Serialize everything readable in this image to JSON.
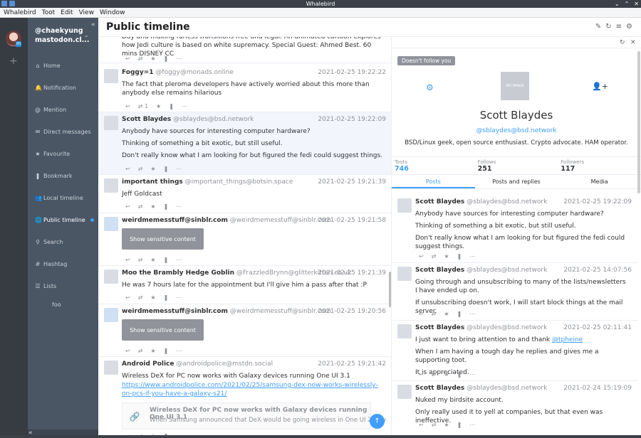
{
  "window": {
    "title": "Whalebird"
  },
  "menu": [
    "Whalebird",
    "Toot",
    "Edit",
    "View",
    "Window"
  ],
  "account": {
    "name": "@chaekyung",
    "server": "mastodon.cl..."
  },
  "nav": [
    {
      "icon": "⌂",
      "label": "Home"
    },
    {
      "icon": "🔔",
      "label": "Notification"
    },
    {
      "icon": "@",
      "label": "Mention"
    },
    {
      "icon": "✉",
      "label": "Direct messages"
    },
    {
      "icon": "★",
      "label": "Favourite"
    },
    {
      "icon": "❚",
      "label": "Bookmark"
    },
    {
      "icon": "👥",
      "label": "Local timeline"
    },
    {
      "icon": "🌐",
      "label": "Public timeline"
    },
    {
      "icon": "⚲",
      "label": "Search"
    },
    {
      "icon": "#",
      "label": "Hashtag"
    },
    {
      "icon": "☰",
      "label": "Lists"
    }
  ],
  "list_sub": "foo",
  "header": {
    "title": "Public timeline"
  },
  "timeline": [
    {
      "body": [
        "Day and making furless transitions free and legal. An animated cartoon explores how Jedi culture is based on white supremacy. Special Guest: Ahmed Best. 60 mins DISNEY CC"
      ]
    },
    {
      "name": "Foggy=1",
      "acct": "@foggy@monads.online",
      "time": "2021-02-25 19:22:22",
      "body": [
        "The fact that pleroma developers have actively worried about this more than anybody else remains hilarious"
      ],
      "reblogs": "1"
    },
    {
      "name": "Scott Blaydes",
      "acct": "@sblaydes@bsd.network",
      "time": "2021-02-25 19:22:09",
      "body": [
        "Anybody have sources for interesting computer hardware?",
        "Thinking of something a bit exotic, but still useful.",
        "Don't really know what I am looking for but figured the fedi could suggest things."
      ]
    },
    {
      "name": "important things",
      "acct": "@important_things@botsin.space",
      "time": "2021-02-25 19:21:39",
      "body": [
        "Jeff Goldcast"
      ]
    },
    {
      "name": "weirdmemesstuff@sinblr.com",
      "acct": "@weirdmemesstuff@sinblr.com",
      "time": "2021-02-25 19:21:58",
      "sensitive": "Show sensitive content"
    },
    {
      "name": "Moo the Brambly Hedge Goblin",
      "acct": "@FrazzledBrynn@glitterkitten.co.uk",
      "time": "2021-02-25 19:21:39",
      "body": [
        "He was 7 hours late for the appointment but I'll give him a pass after that :P"
      ]
    },
    {
      "name": "weirdmemesstuff@sinblr.com",
      "acct": "@weirdmemesstuff@sinblr.com",
      "time": "2021-02-25 19:20:56",
      "sensitive": "Show sensitive content"
    },
    {
      "name": "Android Police",
      "acct": "@androidpolice@mstdn.social",
      "time": "2021-02-25 19:21:42",
      "body": [
        "Wireless DeX for PC now works with Galaxy devices running One UI 3.1"
      ],
      "link": "https://www.androidpolice.com/2021/02/25/samsung-dex-now-works-wirelessly-on-pcs-if-you-have-a-galaxy-s21/",
      "card_title": "Wireless DeX for PC now works with Galaxy devices running One UI 3.1",
      "card_desc": "When Samsung announced that DeX would be going wireless in One UI 2.5, w"
    }
  ],
  "profile": {
    "tag": "Doesn't follow you",
    "avatar_text": "NO IMAGE",
    "name": "Scott Blaydes",
    "acct": "@sblaydes@bsd.network",
    "bio": "BSD/Linux geek, open source enthusiast. Crypto advocate. HAM operator.",
    "stats": [
      {
        "label": "Toots",
        "value": "746"
      },
      {
        "label": "Follows",
        "value": "251"
      },
      {
        "label": "Followers",
        "value": "117"
      }
    ],
    "tabs": [
      "Posts",
      "Posts and replies",
      "Media"
    ],
    "toots": [
      {
        "name": "Scott Blaydes",
        "acct": "@sblaydes@bsd.network",
        "time": "2021-02-25 19:22:09",
        "body": [
          "Anybody have sources for interesting computer hardware?",
          "Thinking of something a bit exotic, but still useful.",
          "Don't really know what I am looking for but figured the fedi could suggest things."
        ]
      },
      {
        "name": "Scott Blaydes",
        "acct": "@sblaydes@bsd.network",
        "time": "2021-02-25 14:07:56",
        "body": [
          "Going through and unsubscribing to many of the lists/newsletters I have ended up on.",
          "If unsubscribing doesn't work, I will start block things at the mail server."
        ]
      },
      {
        "name": "Scott Blaydes",
        "acct": "@sblaydes@bsd.network",
        "time": "2021-02-25 02:11:41",
        "body_pre": "I just want to bring attention to and thank ",
        "mention": "@tpheine",
        "body": [
          "When I am having a tough day he replies and gives me a supporting toot.",
          "It is appreciated."
        ]
      },
      {
        "name": "Scott Blaydes",
        "acct": "@sblaydes@bsd.network",
        "time": "2021-02-24 15:19:09",
        "body": [
          "Nuked my birdsite account.",
          "Only really used it to yell at companies, but that even was ineffective."
        ]
      }
    ]
  }
}
